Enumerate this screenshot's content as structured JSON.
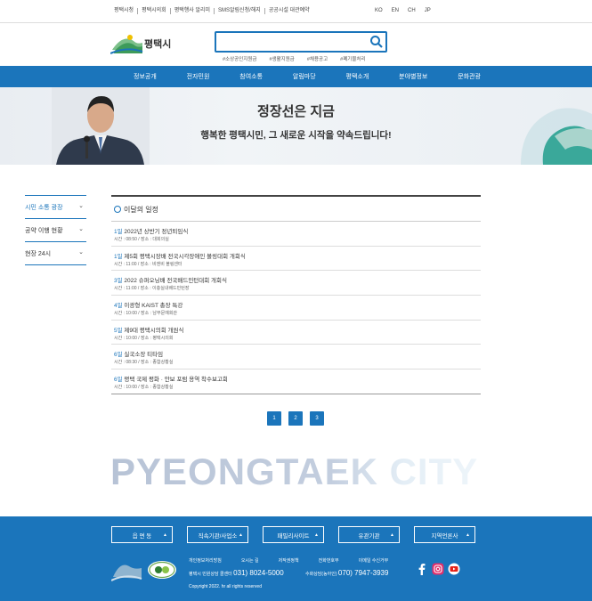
{
  "top_links": [
    "평택시청",
    "평택시의회",
    "평택행사 알리미",
    "SMS알림신청/해지",
    "공공시설 대관예약"
  ],
  "languages": [
    "KO",
    "EN",
    "CH",
    "JP"
  ],
  "logo_text": "평택시",
  "search": {
    "value": "",
    "placeholder": ""
  },
  "hashtags": [
    "#소상공인지원금",
    "#생활지원금",
    "#채용공고",
    "#폐기물처리"
  ],
  "nav": [
    "정보공개",
    "전자민원",
    "참여소통",
    "알림마당",
    "평택소개",
    "분야별정보",
    "문화관광"
  ],
  "banner": {
    "title": "정장선은 지금",
    "subtitle": "행복한 평택시민, 그 새로운 시작을 약속드립니다!"
  },
  "side_menu": [
    "시민 소통 광장",
    "공약 이행 현황",
    "현장 24시"
  ],
  "schedule": {
    "heading": "이달의 일정",
    "items": [
      {
        "day": "1일",
        "title": "2022년 상반기 정년퇴임식",
        "info": "시간 : 08:50 / 장소 : 대회의실"
      },
      {
        "day": "1일",
        "title": "제5회 평택시장배 전국시각장애인 볼링대회 개회식",
        "info": "시간 : 11:00 / 장소 : 비엔비 볼링센터"
      },
      {
        "day": "3일",
        "title": "2022 슈퍼오닝배 전국배드민턴대회 개회식",
        "info": "시간 : 11:00 / 장소 : 이충실내배드민턴장"
      },
      {
        "day": "4일",
        "title": "이광형 KAIST 총장 특강",
        "info": "시간 : 10:00 / 장소 : 남부문예회관"
      },
      {
        "day": "5일",
        "title": "제9대 평택시의회 개원식",
        "info": "시간 : 10:00 / 장소 : 평택시의회"
      },
      {
        "day": "6일",
        "title": "실국소장 티타임",
        "info": "시간 : 08:30 / 장소 : 종합상황실"
      },
      {
        "day": "6일",
        "title": "평택 국제 평화 · 안보 포럼 용역 착수보고회",
        "info": "시간 : 10:00 / 장소 : 종합상황실"
      }
    ]
  },
  "pagination": [
    "1",
    "2",
    "3"
  ],
  "watermark": "PYEONGTAEK CITY",
  "footer": {
    "selects": [
      "읍 면 동",
      "직속기관/사업소",
      "패밀리사이트",
      "유관기관",
      "지역언론사"
    ],
    "links": [
      "개인정보처리방침",
      "오시는 길",
      "저작권정책",
      "전화번호부",
      "이메일 수신거부"
    ],
    "contact1_label": "평택시 민원상담 콜센터",
    "contact1_number": "031) 8024-5000",
    "contact2_label": "수화상담(농아인)",
    "contact2_number": "070) 7947-3939",
    "copyright": "Copyright 2022. hr all rights reserved",
    "accent": "#1b75bb"
  }
}
